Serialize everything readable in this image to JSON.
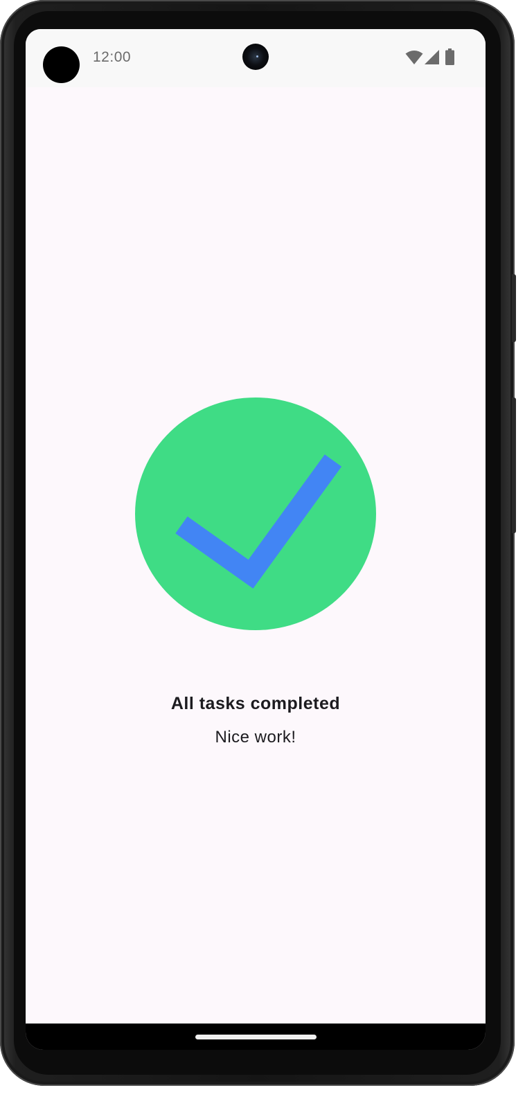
{
  "status_bar": {
    "time": "12:00",
    "icons": [
      "wifi-icon",
      "cellular-signal-icon",
      "battery-icon"
    ],
    "icon_color": "#6b6b6b"
  },
  "main": {
    "graphic": {
      "icon": "check-circle-icon",
      "circle_color": "#3fdc85",
      "check_color": "#4285f4"
    },
    "title": "All tasks completed",
    "subtitle": "Nice work!"
  },
  "colors": {
    "background": "#fdf8fc",
    "text": "#1c1b1f"
  }
}
